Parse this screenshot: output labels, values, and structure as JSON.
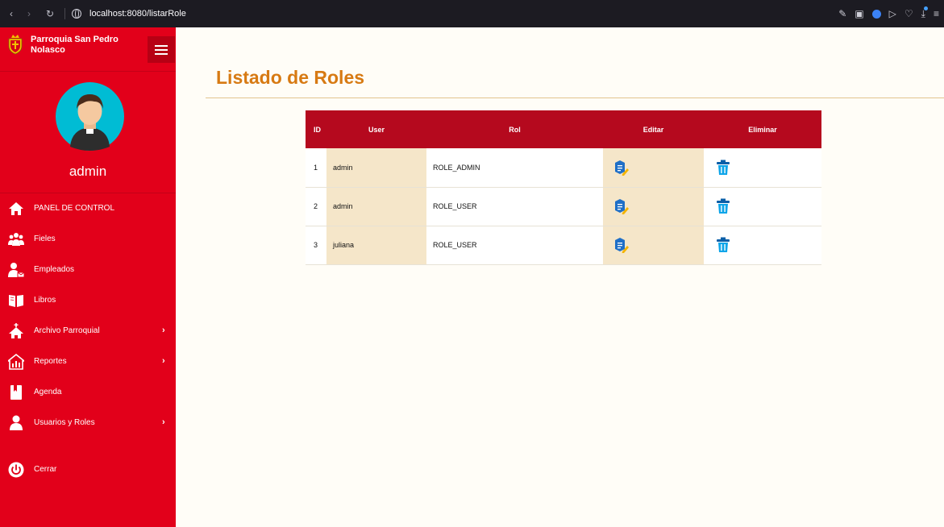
{
  "browser": {
    "url": "localhost:8080/listarRole"
  },
  "sidebar": {
    "brand_name": "Parroquia San Pedro Nolasco",
    "username": "admin",
    "items": [
      {
        "label": "PANEL DE CONTROL",
        "icon": "home-icon",
        "has_submenu": false
      },
      {
        "label": "Fieles",
        "icon": "people-group-icon",
        "has_submenu": false
      },
      {
        "label": "Empleados",
        "icon": "employee-icon",
        "has_submenu": false
      },
      {
        "label": "Libros",
        "icon": "book-icon",
        "has_submenu": false
      },
      {
        "label": "Archivo Parroquial",
        "icon": "church-icon",
        "has_submenu": true
      },
      {
        "label": "Reportes",
        "icon": "reports-icon",
        "has_submenu": true
      },
      {
        "label": "Agenda",
        "icon": "agenda-icon",
        "has_submenu": false
      },
      {
        "label": "Usuarios y Roles",
        "icon": "user-icon",
        "has_submenu": true
      },
      {
        "label": "Cerrar",
        "icon": "power-icon",
        "has_submenu": false
      }
    ]
  },
  "main": {
    "title": "Listado de Roles",
    "table": {
      "headers": {
        "id": "ID",
        "user": "User",
        "rol": "Rol",
        "editar": "Editar",
        "eliminar": "Eliminar"
      },
      "rows": [
        {
          "id": "1",
          "user": "admin",
          "rol": "ROLE_ADMIN"
        },
        {
          "id": "2",
          "user": "admin",
          "rol": "ROLE_USER"
        },
        {
          "id": "3",
          "user": "juliana",
          "rol": "ROLE_USER"
        }
      ]
    }
  },
  "colors": {
    "sidebar": "#e2001a",
    "table_header": "#b5091e",
    "title": "#d77a13",
    "highlight_column": "#f5e6c9"
  }
}
